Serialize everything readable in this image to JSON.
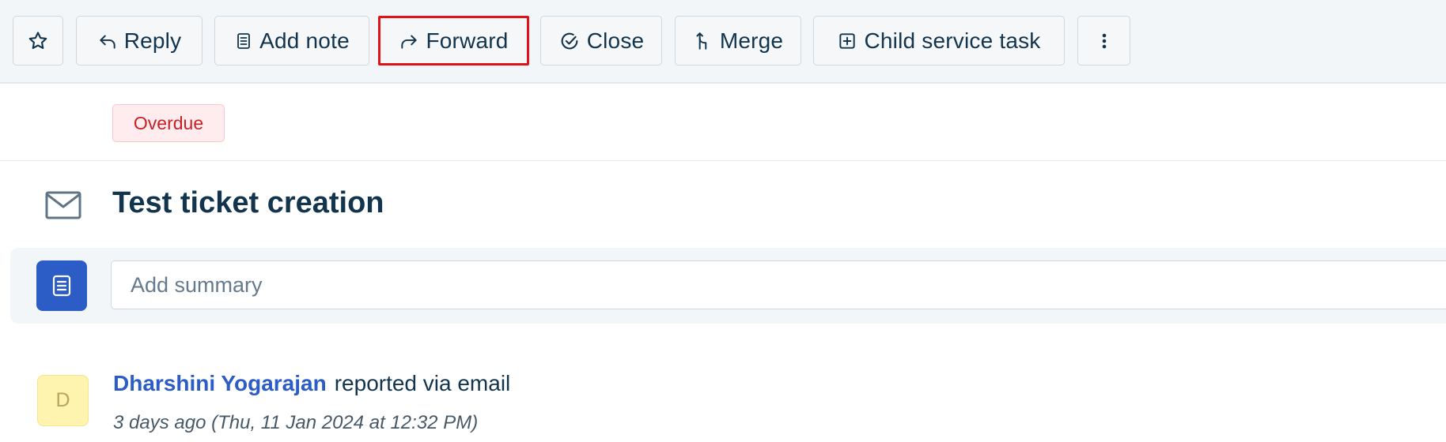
{
  "toolbar": {
    "star_icon": "star-icon",
    "buttons": [
      {
        "id": "reply",
        "label": "Reply",
        "icon": "reply-icon"
      },
      {
        "id": "add-note",
        "label": "Add note",
        "icon": "note-icon"
      },
      {
        "id": "forward",
        "label": "Forward",
        "icon": "forward-icon",
        "active": true
      },
      {
        "id": "close",
        "label": "Close",
        "icon": "check-circle-icon"
      },
      {
        "id": "merge",
        "label": "Merge",
        "icon": "merge-icon"
      },
      {
        "id": "child-service-task",
        "label": "Child service task",
        "icon": "plus-square-icon"
      }
    ],
    "more_icon": "more-vertical-icon",
    "active_color": "#e0131a"
  },
  "status": {
    "badge": "Overdue",
    "color": "#c82124"
  },
  "ticket": {
    "title": "Test ticket creation",
    "channel_icon": "mail-icon",
    "summary_placeholder": "Add summary",
    "summary_icon": "summary-document-icon",
    "accent": "#2c5cc5"
  },
  "conversation": {
    "avatar_initial": "D",
    "reporter_name": "Dharshini Yogarajan",
    "reported_via": "reported via email",
    "time": "3 days ago (Thu, 11 Jan 2024 at 12:32 PM)"
  }
}
